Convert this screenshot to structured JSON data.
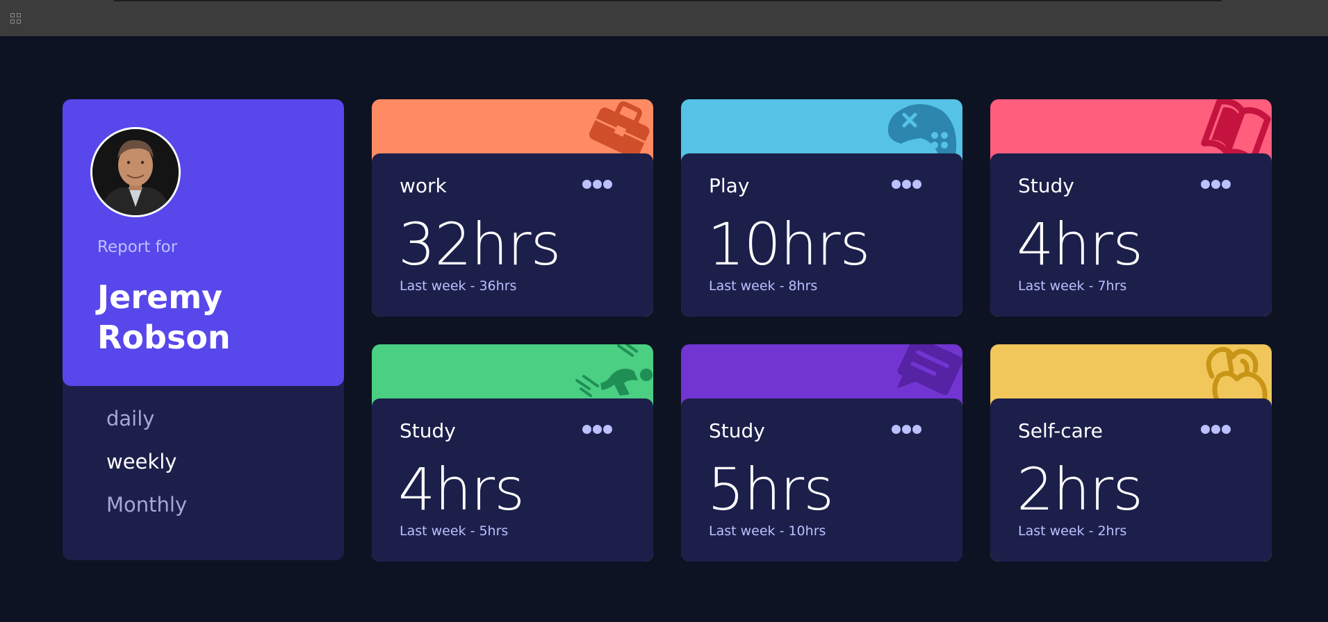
{
  "topbar": {
    "apps_icon": "grid-apps-icon"
  },
  "profile": {
    "report_label": "Report for",
    "name": "Jeremy Robson",
    "periods": [
      "daily",
      "weekly",
      "Monthly"
    ],
    "active_period": "weekly",
    "accent_color": "#5847eb"
  },
  "cards": [
    {
      "title": "work",
      "hours": "32hrs",
      "last": "Last week - 36hrs",
      "color": "#ff8b64",
      "icon": "briefcase-icon",
      "menu_icon": "ellipsis-icon"
    },
    {
      "title": "Play",
      "hours": "10hrs",
      "last": "Last week - 8hrs",
      "color": "#55c2e6",
      "icon": "gamepad-icon",
      "menu_icon": "ellipsis-icon"
    },
    {
      "title": "Study",
      "hours": "4hrs",
      "last": "Last week - 7hrs",
      "color": "#ff5e7d",
      "icon": "book-icon",
      "menu_icon": "ellipsis-icon"
    },
    {
      "title": "Study",
      "hours": "4hrs",
      "last": "Last week - 5hrs",
      "color": "#4bcf82",
      "icon": "runner-icon",
      "menu_icon": "ellipsis-icon"
    },
    {
      "title": "Study",
      "hours": "5hrs",
      "last": "Last week - 10hrs",
      "color": "#7335d2",
      "icon": "chat-bubble-icon",
      "menu_icon": "ellipsis-icon"
    },
    {
      "title": "Self-care",
      "hours": "2hrs",
      "last": "Last week - 2hrs",
      "color": "#f1c75b",
      "icon": "self-care-icon",
      "menu_icon": "ellipsis-icon"
    }
  ]
}
